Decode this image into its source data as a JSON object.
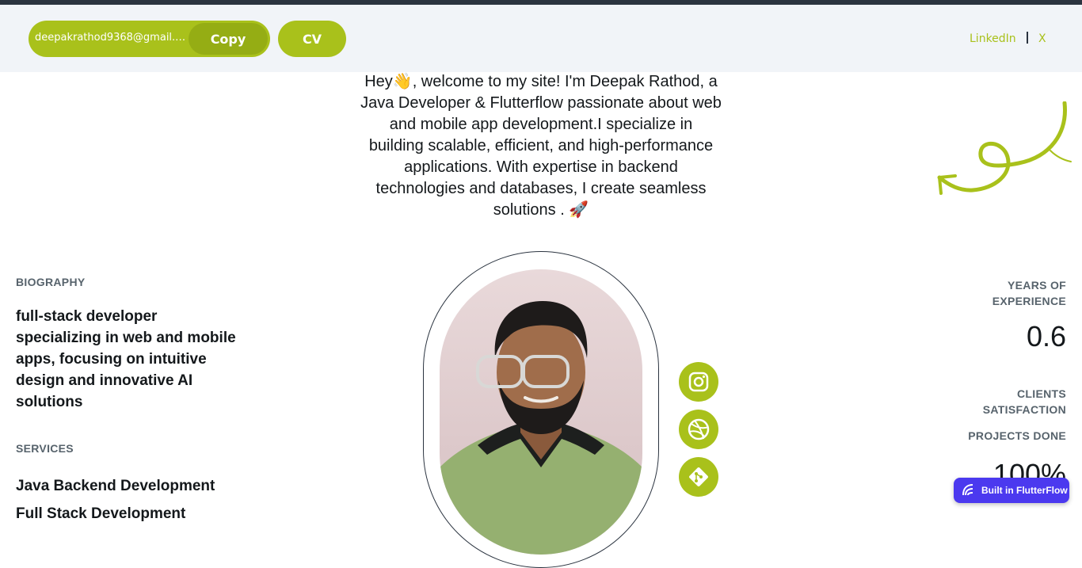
{
  "header": {
    "email": "deepakrathod9368@gmail.co...",
    "copy_label": "Copy",
    "cv_label": "CV",
    "nav_links": [
      "LinkedIn",
      "X"
    ]
  },
  "intro": {
    "text": "Hey👋, welcome to my site!  I'm Deepak Rathod, a Java Developer & Flutterflow passionate about web and mobile app development.I specialize in building scalable, efficient, and high-performance applications. With expertise in backend technologies and databases, I create seamless solutions . 🚀"
  },
  "biography": {
    "label": "BIOGRAPHY",
    "text": "full-stack developer specializing in web and mobile apps, focusing on intuitive design and innovative AI solutions"
  },
  "services": {
    "label": "SERVICES",
    "items": [
      "Java Backend Development",
      "Full Stack Development"
    ]
  },
  "stats": {
    "years_label": "YEARS OF EXPERIENCE",
    "years_value": "0.6",
    "clients_label": "CLIENTS SATISFACTION",
    "projects_label": "PROJECTS DONE",
    "clients_value": "100%"
  },
  "social": {
    "icons": [
      "instagram-icon",
      "dribbble-icon",
      "git-icon"
    ]
  },
  "badge": {
    "label": "Built in FlutterFlow"
  },
  "colors": {
    "accent": "#a9c11b",
    "header_bg": "#f1f4f8",
    "text": "#14181b",
    "muted": "#57636c",
    "badge_bg": "#4b39ef"
  }
}
